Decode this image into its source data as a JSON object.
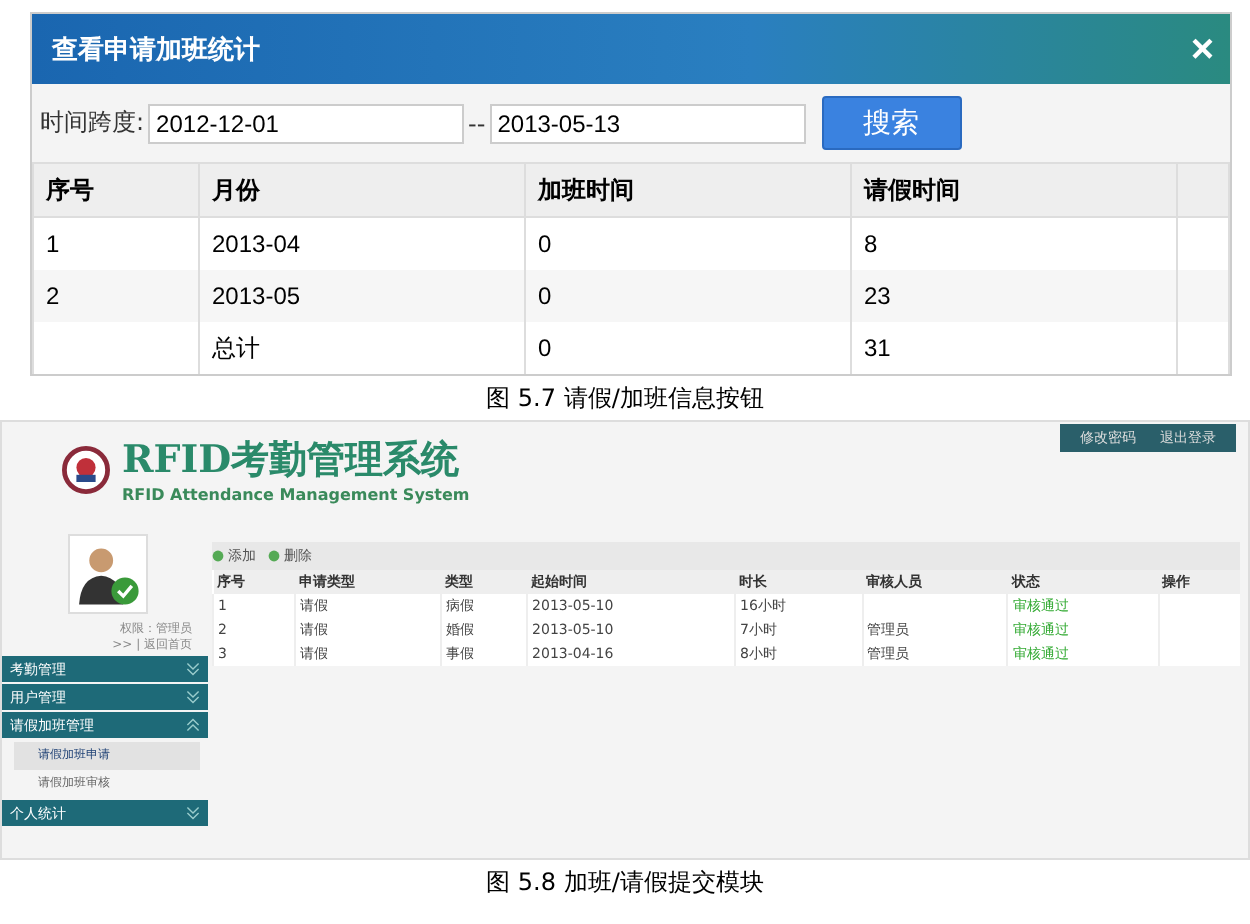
{
  "dialog": {
    "title": "查看申请加班统计",
    "close": "×",
    "filter_label": "时间跨度:",
    "date_from": "2012-12-01",
    "separator": "--",
    "date_to": "2013-05-13",
    "search_button": "搜索",
    "table": {
      "columns": [
        "序号",
        "月份",
        "加班时间",
        "请假时间"
      ],
      "rows": [
        [
          "1",
          "2013-04",
          "0",
          "8"
        ],
        [
          "2",
          "2013-05",
          "0",
          "23"
        ],
        [
          "",
          "总计",
          "0",
          "31"
        ]
      ]
    }
  },
  "caption_1": "图 5.7 请假/加班信息按钮",
  "app": {
    "title": "RFID考勤管理系统",
    "subtitle": "RFID Attendance Management System",
    "top_links": [
      "修改密码",
      "退出登录"
    ],
    "user_info": [
      "权限：管理员",
      ">> | 返回首页"
    ],
    "menu": [
      {
        "label": "考勤管理",
        "expanded": false
      },
      {
        "label": "用户管理",
        "expanded": false
      },
      {
        "label": "请假加班管理",
        "expanded": true,
        "children": [
          {
            "label": "请假加班申请",
            "selected": true
          },
          {
            "label": "请假加班审核",
            "selected": false
          }
        ]
      },
      {
        "label": "个人统计",
        "expanded": false
      }
    ],
    "toolbar": [
      "添加",
      "删除"
    ],
    "table": {
      "columns": [
        "序号",
        "申请类型",
        "类型",
        "起始时间",
        "时长",
        "审核人员",
        "状态",
        "操作"
      ],
      "rows": [
        [
          "1",
          "请假",
          "病假",
          "2013-05-10",
          "16小时",
          "",
          "审核通过",
          ""
        ],
        [
          "2",
          "请假",
          "婚假",
          "2013-05-10",
          "7小时",
          "管理员",
          "审核通过",
          ""
        ],
        [
          "3",
          "请假",
          "事假",
          "2013-04-16",
          "8小时",
          "管理员",
          "审核通过",
          ""
        ]
      ]
    }
  },
  "caption_2": "图 5.8 加班/请假提交模块"
}
